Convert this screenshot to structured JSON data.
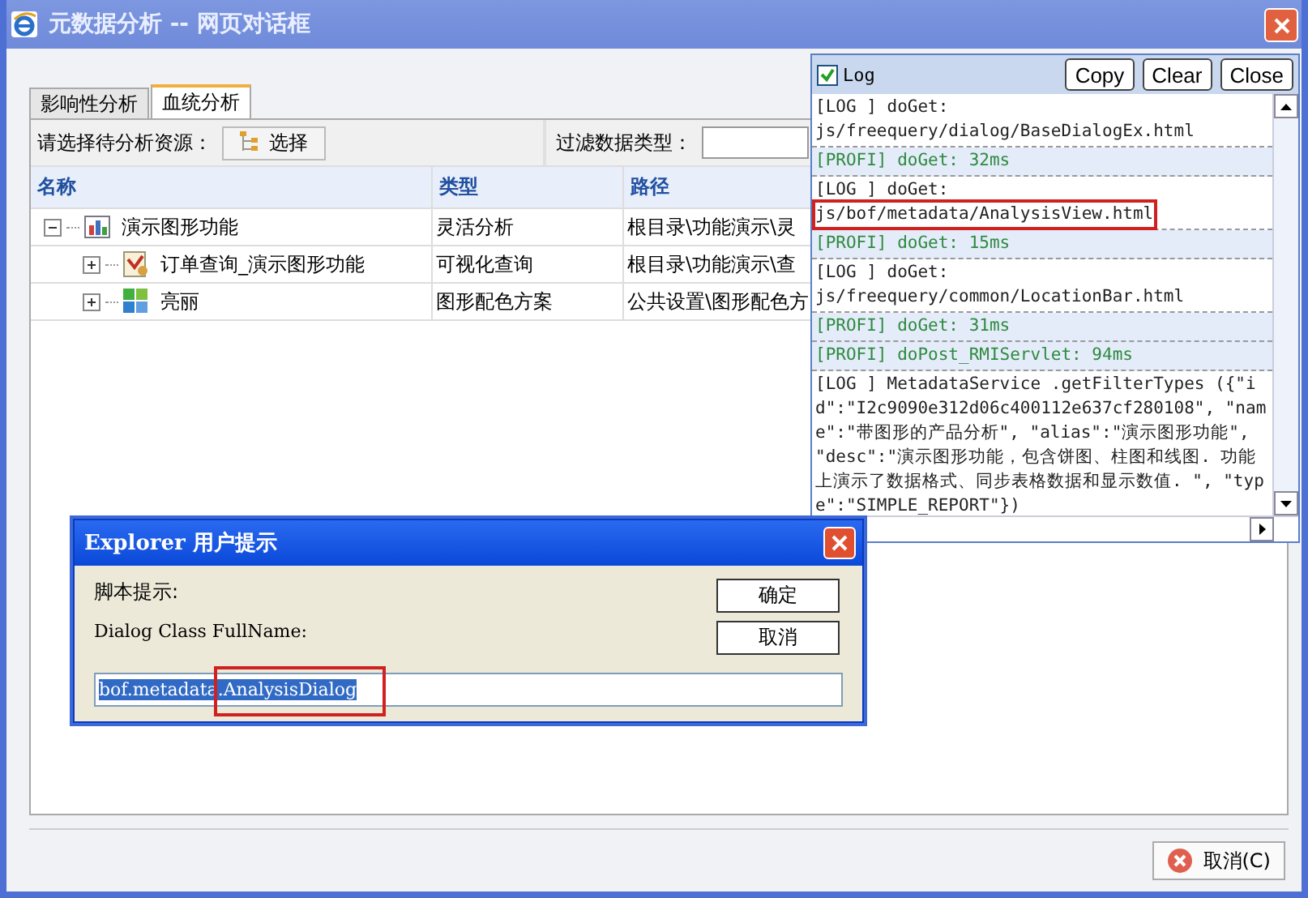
{
  "window": {
    "title": "元数据分析 -- 网页对话框"
  },
  "tabs": [
    {
      "label": "影响性分析",
      "selected": false
    },
    {
      "label": "血统分析",
      "selected": true
    }
  ],
  "toolbar": {
    "resource_label": "请选择待分析资源：",
    "select_button": "选择",
    "filter_label": "过滤数据类型："
  },
  "table": {
    "columns": [
      "名称",
      "类型",
      "路径"
    ],
    "rows": [
      {
        "name": "演示图形功能",
        "kind": "chart",
        "type": "灵活分析",
        "path": "根目录\\功能演示\\灵",
        "expanded": true,
        "children": [
          {
            "name": "订单查询_演示图形功能",
            "kind": "query",
            "type": "可视化查询",
            "path": "根目录\\功能演示\\查",
            "expanded": false
          },
          {
            "name": "亮丽",
            "kind": "palette",
            "type": "图形配色方案",
            "path": "公共设置\\图形配色方",
            "expanded": false
          }
        ]
      }
    ]
  },
  "log_panel": {
    "checkbox": {
      "label": "Log",
      "checked": true
    },
    "buttons": [
      "Copy",
      "Clear",
      "Close"
    ],
    "entries": [
      {
        "kind": "log",
        "lines": [
          {
            "text": "[LOG  ] doGet:",
            "highlighted": false
          },
          {
            "text": "js/freequery/dialog/BaseDialogEx.html",
            "highlighted": false
          }
        ]
      },
      {
        "kind": "profile",
        "lines": [
          {
            "text": "[PROFI] doGet: 32ms",
            "highlighted": false
          }
        ]
      },
      {
        "kind": "log",
        "lines": [
          {
            "text": "[LOG  ] doGet:",
            "highlighted": false
          },
          {
            "text": "js/bof/metadata/AnalysisView.html",
            "highlighted": true
          }
        ]
      },
      {
        "kind": "profile",
        "lines": [
          {
            "text": "[PROFI] doGet: 15ms",
            "highlighted": false
          }
        ]
      },
      {
        "kind": "log",
        "lines": [
          {
            "text": "[LOG  ] doGet:",
            "highlighted": false
          },
          {
            "text": "js/freequery/common/LocationBar.html",
            "highlighted": false
          }
        ]
      },
      {
        "kind": "profile",
        "lines": [
          {
            "text": "[PROFI] doGet: 31ms",
            "highlighted": false
          }
        ]
      },
      {
        "kind": "profile",
        "lines": [
          {
            "text": "[PROFI] doPost_RMIServlet: 94ms",
            "highlighted": false
          }
        ]
      },
      {
        "kind": "log",
        "lines": [
          {
            "text": "[LOG  ] MetadataService .getFilterTypes ({\"id\":\"I2c9090e312d06c400112e637cf280108\", \"name\":\"带图形的产品分析\", \"alias\":\"演示图形功能\", \"desc\":\"演示图形功能，包含饼图、柱图和线图. 功能上演示了数据格式、同步表格数据和显示数值. \", \"type\":\"SIMPLE_REPORT\"})",
            "highlighted": false
          }
        ]
      }
    ]
  },
  "prompt_dialog": {
    "title": "Explorer 用户提示",
    "message": "脚本提示:",
    "label": "Dialog Class FullName:",
    "value": "bof.metadata.AnalysisDialog",
    "value_selected": true,
    "annotation_box": true,
    "buttons": [
      "确定",
      "取消"
    ]
  },
  "footer": {
    "cancel_button": "取消(C)"
  }
}
